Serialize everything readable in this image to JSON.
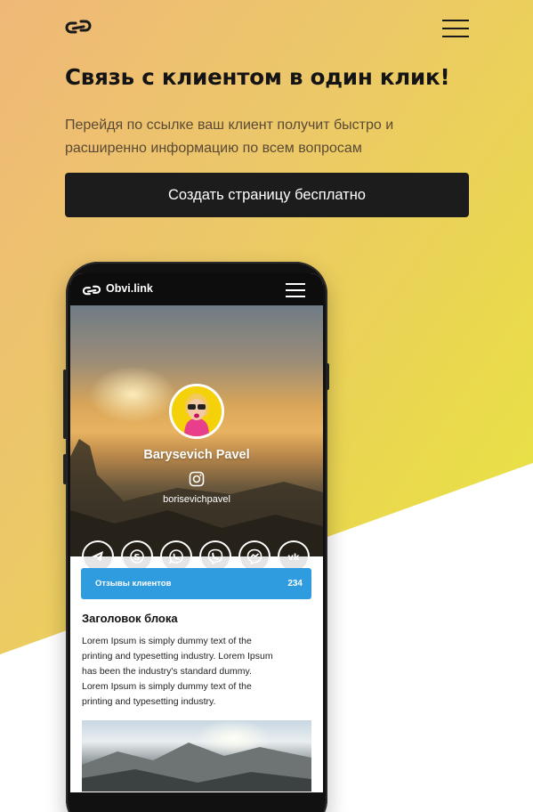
{
  "hero": {
    "title": "Связь с клиентом в один клик!",
    "subtitle_line1": "Перейдя по ссылке ваш клиент получит быстро и",
    "subtitle_line2": "расширенно информацию по всем вопросам",
    "cta_label": "Создать страницу бесплатно"
  },
  "icons": {
    "logo": "link-icon",
    "menu": "hamburger-icon"
  },
  "phone": {
    "brand": "Obvi.link",
    "profile": {
      "name": "Barysevich Pavel",
      "handle": "borisevichpavel",
      "handle_icon": "instagram-icon"
    },
    "socials": [
      {
        "name": "telegram-icon"
      },
      {
        "name": "skype-icon"
      },
      {
        "name": "whatsapp-icon"
      },
      {
        "name": "viber-icon"
      },
      {
        "name": "messenger-icon"
      },
      {
        "name": "vk-icon"
      }
    ],
    "reviews": {
      "label": "Отзывы клиентов",
      "count": "234"
    },
    "block": {
      "title": "Заголовок блока",
      "lines": [
        "Lorem Ipsum is simply dummy text of the",
        "printing and typesetting industry. Lorem Ipsum",
        "has been the industry's standard dummy.",
        "Lorem Ipsum is simply dummy text of the",
        "printing and typesetting industry."
      ]
    }
  },
  "colors": {
    "accent_blue": "#2f9ce0",
    "cta_bg": "#1c1c1c",
    "gradient_start": "#efb878",
    "gradient_end": "#e6ee3c"
  }
}
